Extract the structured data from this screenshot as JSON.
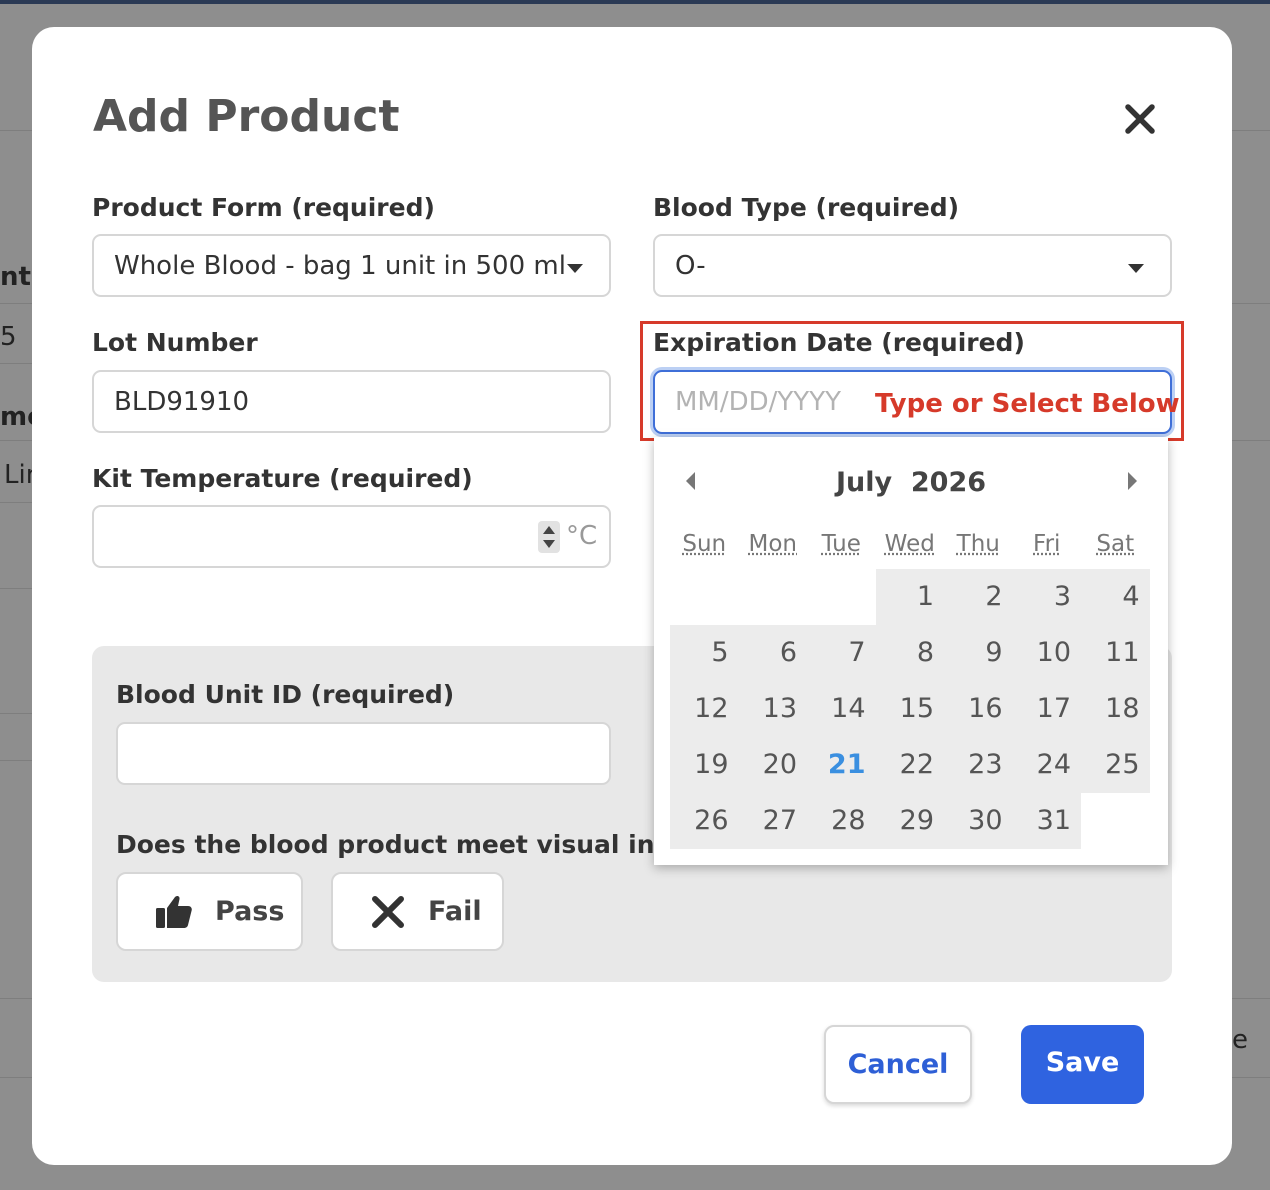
{
  "background": {
    "fragments": [
      "nt I",
      "5",
      "me",
      "Lin",
      "e"
    ]
  },
  "modal": {
    "title": "Add Product",
    "close_icon": "close-icon"
  },
  "form": {
    "product_form": {
      "label": "Product Form (required)",
      "value": "Whole Blood - bag 1 unit in 500 ml"
    },
    "blood_type": {
      "label": "Blood Type (required)",
      "value": "O-"
    },
    "lot_number": {
      "label": "Lot Number",
      "value": "BLD91910"
    },
    "expiration": {
      "label": "Expiration Date (required)",
      "placeholder": "MM/DD/YYYY",
      "hint": "Type or Select Below"
    },
    "kit_temperature": {
      "label": "Kit Temperature (required)",
      "value": "",
      "unit": "°C"
    }
  },
  "inspection": {
    "unit_id_label": "Blood Unit ID (required)",
    "unit_id_value": "",
    "question": "Does the blood product meet visual inspect",
    "pass_label": "Pass",
    "fail_label": "Fail",
    "pass_icon": "thumbs-up-icon",
    "fail_icon": "x-icon"
  },
  "calendar": {
    "month_title": "July  2026",
    "weekdays": [
      "Sun",
      "Mon",
      "Tue",
      "Wed",
      "Thu",
      "Fri",
      "Sat"
    ],
    "first_weekday_index": 3,
    "days_in_month": 31,
    "today": 21,
    "today_color": "#3a8fe0"
  },
  "footer": {
    "cancel_label": "Cancel",
    "save_label": "Save",
    "save_color": "#2f63e0"
  }
}
